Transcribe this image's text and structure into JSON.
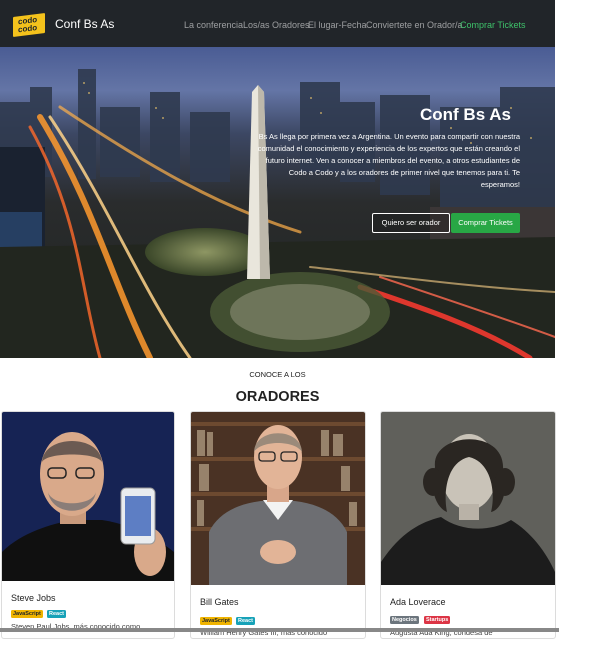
{
  "navbar": {
    "logo_line1": "codo",
    "logo_line2": "codo",
    "brand": "Conf Bs As",
    "links": [
      "La conferencia",
      "Los/as Oradores",
      "El lugar-Fecha",
      "Conviertete en Orador/a",
      "Comprar Tickets"
    ]
  },
  "hero": {
    "title": "Conf Bs As",
    "text": "Bs As llega por primera vez a Argentina. Un evento para compartir con nuestra comunidad el conocimiento y experiencia de los expertos que están creando el futuro internet. Ven a conocer a miembros del evento, a otros estudiantes de Codo a Codo y a los oradores de primer nivel que tenemos para ti. Te esperamos!",
    "btn_orador": "Quiero ser orador",
    "btn_tickets": "Comprar Tickets"
  },
  "speakers": {
    "kicker": "CONOCE A LOS",
    "heading": "ORADORES",
    "cards": [
      {
        "name": "Steve Jobs",
        "badges": [
          "JavaScript",
          "React"
        ],
        "desc": "Steven Paul Jobs, más conocido como"
      },
      {
        "name": "Bill Gates",
        "badges": [
          "JavaScript",
          "React"
        ],
        "desc": "William Henry Gates III, más conocido"
      },
      {
        "name": "Ada Loverace",
        "badges": [
          "Negocios",
          "Startups"
        ],
        "desc": "Augusta Ada King, condesa de"
      }
    ]
  },
  "colors": {
    "navbar_bg": "#212529",
    "accent_green": "#28a745",
    "badge_yellow": "#f0b400",
    "badge_teal": "#17a2b8",
    "badge_grey": "#6c757d",
    "badge_red": "#dc3545"
  }
}
